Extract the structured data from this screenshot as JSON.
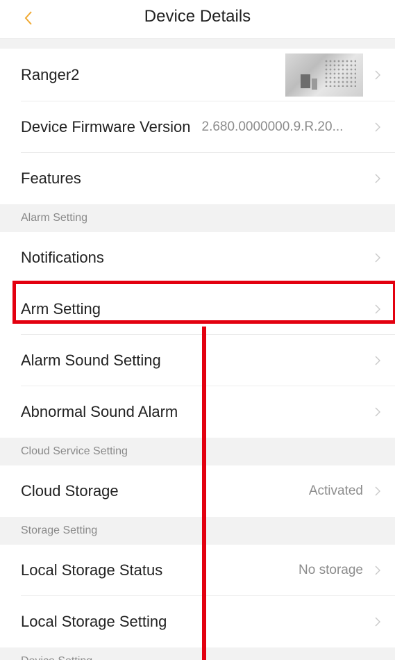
{
  "header": {
    "title": "Device Details",
    "back_icon": "chevron-left-icon",
    "accent_color": "#f0a830"
  },
  "device": {
    "name": "Ranger2",
    "thumbnail": "device-thumbnail-image"
  },
  "firmware": {
    "label": "Device Firmware Version",
    "value": "2.680.0000000.9.R.20..."
  },
  "features": {
    "label": "Features"
  },
  "sections": {
    "alarm": "Alarm Setting",
    "cloud": "Cloud Service Setting",
    "storage": "Storage Setting",
    "device": "Device Setting"
  },
  "alarm_items": {
    "notifications": "Notifications",
    "arm_setting": "Arm Setting",
    "alarm_sound": "Alarm Sound Setting",
    "abnormal_sound": "Abnormal Sound Alarm"
  },
  "cloud_items": {
    "cloud_storage": {
      "label": "Cloud Storage",
      "value": "Activated"
    }
  },
  "storage_items": {
    "local_status": {
      "label": "Local Storage Status",
      "value": "No storage"
    },
    "local_setting": {
      "label": "Local Storage Setting"
    }
  },
  "annotation": {
    "highlight_color": "#e3000f",
    "highlighted_item": "Arm Setting"
  }
}
